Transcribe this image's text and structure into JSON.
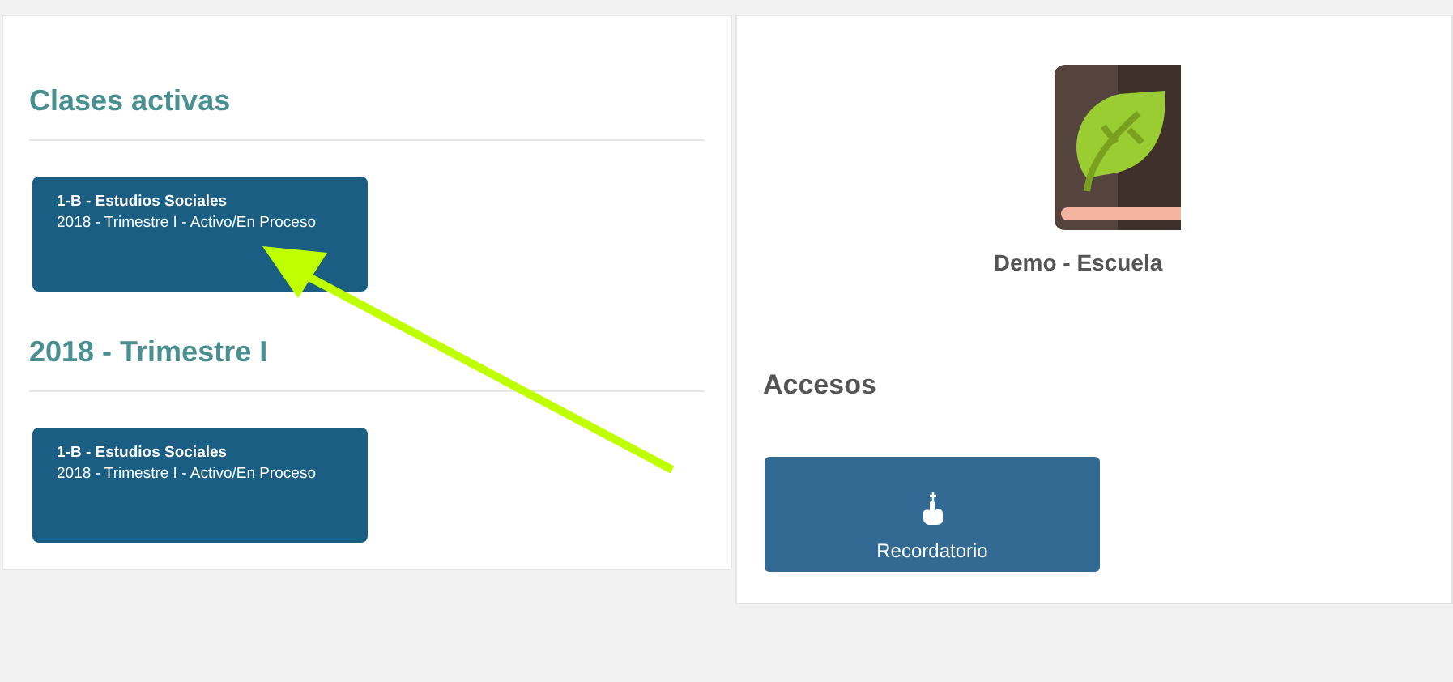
{
  "sections": [
    {
      "title": "Clases activas",
      "classes": [
        {
          "title": "1-B - Estudios Sociales",
          "subtitle": "2018 - Trimestre I - Activo/En Proceso"
        }
      ]
    },
    {
      "title": "2018 - Trimestre I",
      "classes": [
        {
          "title": "1-B - Estudios Sociales",
          "subtitle": "2018 - Trimestre I - Activo/En Proceso"
        }
      ]
    }
  ],
  "school": {
    "name": "Demo - Escuela"
  },
  "accesses": {
    "title": "Accesos",
    "buttons": [
      {
        "label": "Recordatorio"
      }
    ]
  }
}
